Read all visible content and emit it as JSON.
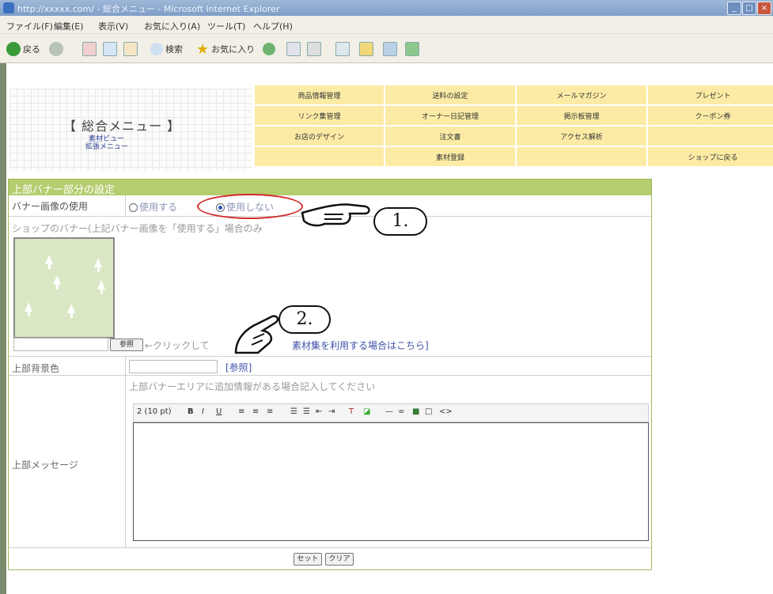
{
  "browser": {
    "window_title": "http://xxxxx.com/ - 総合メニュー - Microsoft Internet Explorer",
    "menus": [
      "ファイル(F)",
      "編集(E)",
      "表示(V)",
      "お気に入り(A)",
      "ツール(T)",
      "ヘルプ(H)"
    ],
    "toolbar": {
      "back": "戻る",
      "search": "検索",
      "favorites": "お気に入り"
    }
  },
  "header": {
    "title": "【 総合メニュー 】",
    "links": [
      "素材ビュー",
      "拡張メニュー"
    ]
  },
  "nav": [
    "商品情報管理",
    "送料の設定",
    "メールマガジン",
    "プレゼント",
    "リンク集管理",
    "オーナー日記管理",
    "掲示板管理",
    "クーポン券",
    "お店のデザイン",
    "注文書",
    "アクセス解析",
    "",
    "",
    "素材登録",
    "",
    "ショップに戻る"
  ],
  "form": {
    "section_title": "上部バナー部分の設定",
    "banner_use": {
      "label": "バナー画像の使用",
      "options": [
        "使用する",
        "使用しない"
      ],
      "selected": "使用しない"
    },
    "shop_banner_label": "ショップのバナー(上記バナー画像を「使用する」場合のみ",
    "browse_button": "参照",
    "upload_hint": "←クリックして",
    "material_link": "素材集を利用する場合はこちら]",
    "bg_color": {
      "label": "上部背景色",
      "value": "",
      "ref_link": "[参照]"
    },
    "message": {
      "label": "上部メッセージ",
      "hint": "上部バナーエリアに追加情報がある場合記入してください",
      "font_size": "2 (10 pt)",
      "toolbar_buttons": [
        "B",
        "I",
        "U"
      ]
    },
    "set_button": "セット",
    "clear_button": "クリア"
  },
  "annotations": [
    "1.",
    "2."
  ],
  "colors": {
    "nav_bg": "#fbeba5",
    "section_bar": "#b5cd6f",
    "annotation_ring": "#d42a2a"
  }
}
